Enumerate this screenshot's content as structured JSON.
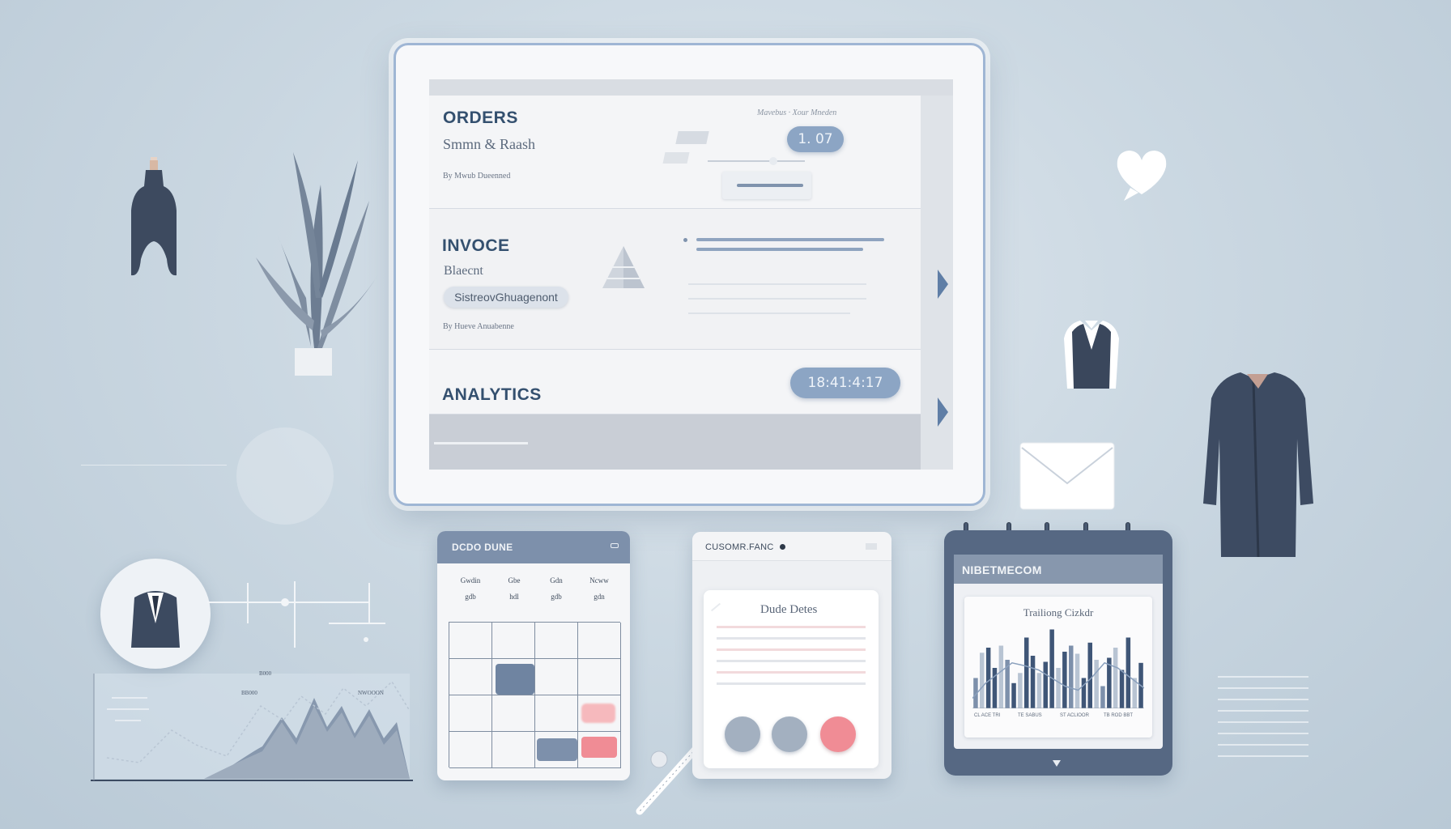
{
  "tablet": {
    "orders": {
      "title": "ORDERS",
      "subtitle": "Smmn & Raash",
      "byline": "By Mwub Dueenned",
      "breadcrumb": "Mavebus · Xour Mneden",
      "pill": "1. 07"
    },
    "invoice": {
      "title": "INVOCE",
      "subtitle": "Blaecnt",
      "tag": "SistreovGhuagenont",
      "byline": "By Hueve Anuabenne"
    },
    "analytics": {
      "title": "ANALYTICS",
      "pill": "18:41:4:17"
    }
  },
  "calendar_card": {
    "title": "DCDO DUNE",
    "days": [
      "Gwdin",
      "Gbe",
      "Gdn",
      "Ncww"
    ],
    "day_values": [
      "gdb",
      "hdl",
      "gdb",
      "gdn"
    ]
  },
  "customer_card": {
    "title": "CUSOMR.FANC",
    "inner_title": "Dude Detes"
  },
  "report_card": {
    "title": "NIBETMECOM",
    "chart_title": "Trailiong Cizkdr",
    "axis_labels": [
      "CL ACE TRI",
      "TE SABUS",
      "ST ACLIOOR",
      "TB ROD BBT"
    ],
    "chart_data": {
      "type": "bar",
      "values": [
        30,
        55,
        60,
        40,
        62,
        48,
        25,
        35,
        70,
        52,
        35,
        46,
        78,
        40,
        56,
        62,
        54,
        30,
        65,
        48,
        22,
        50,
        60,
        38,
        70,
        30,
        45
      ],
      "line": [
        10,
        25,
        35,
        45,
        42,
        38,
        30,
        22,
        18,
        30,
        45,
        40,
        30,
        20
      ]
    }
  },
  "mountain_chart": {
    "labels": [
      "B000",
      "BB000",
      "NWOOON"
    ]
  },
  "colors": {
    "background": "#c8d6e1",
    "accent": "#8ca5c4",
    "navy": "#3f4e66",
    "pink": "#f08c95"
  }
}
